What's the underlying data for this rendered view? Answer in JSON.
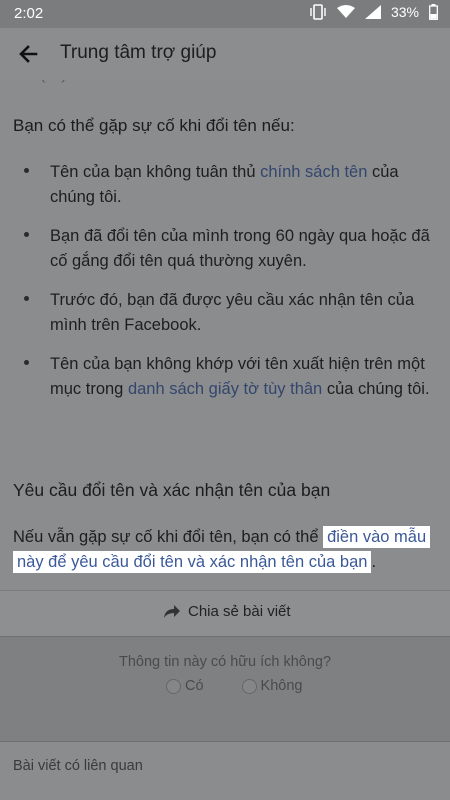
{
  "status_bar": {
    "time": "2:02",
    "battery": "33%"
  },
  "header": {
    "title": "Trung tâm trợ giúp"
  },
  "content": {
    "cut_line": "(…)…",
    "intro": "Bạn có thể gặp sự cố khi đổi tên nếu:",
    "bullets": [
      {
        "pre": "Tên của bạn không tuân thủ ",
        "link": "chính sách tên",
        "post": " của chúng tôi."
      },
      {
        "pre": "Bạn đã đổi tên của mình trong 60 ngày qua hoặc đã cố gắng đổi tên quá thường xuyên.",
        "link": "",
        "post": ""
      },
      {
        "pre": "Trước đó, bạn đã được yêu cầu xác nhận tên của mình trên Facebook.",
        "link": "",
        "post": ""
      },
      {
        "pre": "Tên của bạn không khớp với tên xuất hiện trên một mục trong ",
        "link": "danh sách giấy tờ tùy thân",
        "post": " của chúng tôi."
      }
    ],
    "section_title": "Yêu cầu đổi tên và xác nhận tên của bạn",
    "para_pre": "Nếu vẫn gặp sự cố khi đổi tên, bạn có thể ",
    "para_link": "điền vào mẫu này để yêu cầu đổi tên và xác nhận tên của bạn",
    "para_post": "."
  },
  "share": {
    "label": "Chia sẻ bài viết",
    "icon": "share-arrow-icon"
  },
  "feedback": {
    "question": "Thông tin này có hữu ích không?",
    "yes": "Có",
    "no": "Không"
  },
  "related": {
    "title": "Bài viết có liên quan"
  }
}
